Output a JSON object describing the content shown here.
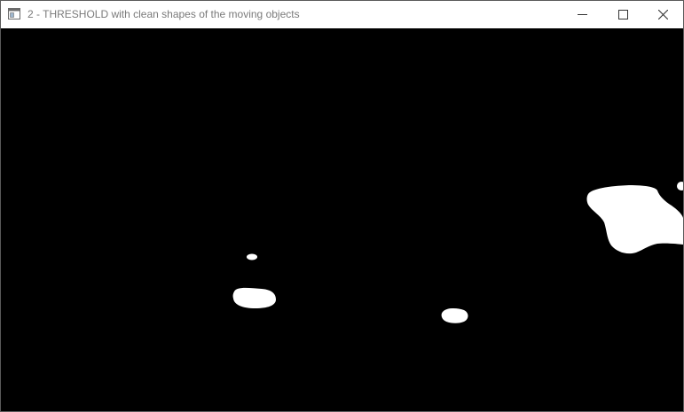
{
  "window": {
    "title": "2 - THRESHOLD with clean shapes of the moving objects",
    "icon": "app-window-icon",
    "controls": [
      "minimize-icon",
      "maximize-icon",
      "close-icon"
    ]
  },
  "image": {
    "background_color": "#000000",
    "blob_color": "#ffffff",
    "blob_count": 5
  }
}
